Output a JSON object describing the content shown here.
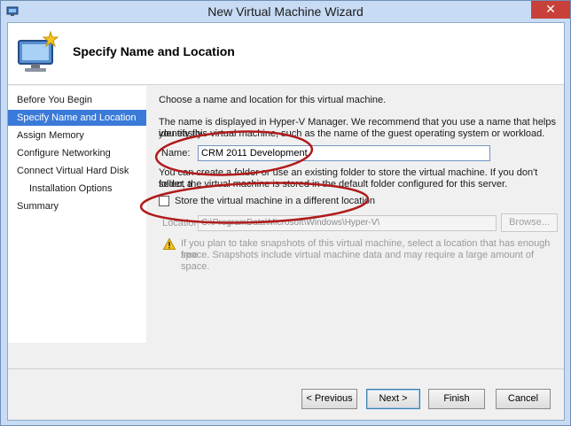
{
  "window": {
    "title": "New Virtual Machine Wizard",
    "close_glyph": "✕"
  },
  "header": {
    "title": "Specify Name and Location",
    "icon": "new-vm-icon"
  },
  "nav": {
    "items": [
      {
        "label": "Before You Begin",
        "active": false,
        "sub": false
      },
      {
        "label": "Specify Name and Location",
        "active": true,
        "sub": false
      },
      {
        "label": "Assign Memory",
        "active": false,
        "sub": false
      },
      {
        "label": "Configure Networking",
        "active": false,
        "sub": false
      },
      {
        "label": "Connect Virtual Hard Disk",
        "active": false,
        "sub": false
      },
      {
        "label": "Installation Options",
        "active": false,
        "sub": true
      },
      {
        "label": "Summary",
        "active": false,
        "sub": false
      }
    ]
  },
  "content": {
    "intro": "Choose a name and location for this virtual machine.",
    "name_help_1": "The name is displayed in Hyper-V Manager. We recommend that you use a name that helps you easily",
    "name_help_2": "identify this virtual machine, such as the name of the guest operating system or workload.",
    "name_label": "Name:",
    "name_value": "CRM 2011 Development",
    "folder_help_1": "You can create a folder or use an existing folder to store the virtual machine. If you don't select a",
    "folder_help_2": "folder, the virtual machine is stored in the default folder configured for this server.",
    "store_checkbox_label": "Store the virtual machine in a different location",
    "store_checked": false,
    "location_label": "Location:",
    "location_value": "C:\\ProgramData\\Microsoft\\Windows\\Hyper-V\\",
    "browse_label": "Browse...",
    "warning_1": "If you plan to take snapshots of this virtual machine, select a location that has enough free",
    "warning_2": "space. Snapshots include virtual machine data and may require a large amount of space."
  },
  "footer": {
    "previous_label": "< Previous",
    "next_label": "Next >",
    "finish_label": "Finish",
    "cancel_label": "Cancel"
  },
  "colors": {
    "accent": "#3a7ad8",
    "annotation": "#b01b1b",
    "titlebar": "#c7dcf4",
    "close": "#c7413a"
  }
}
